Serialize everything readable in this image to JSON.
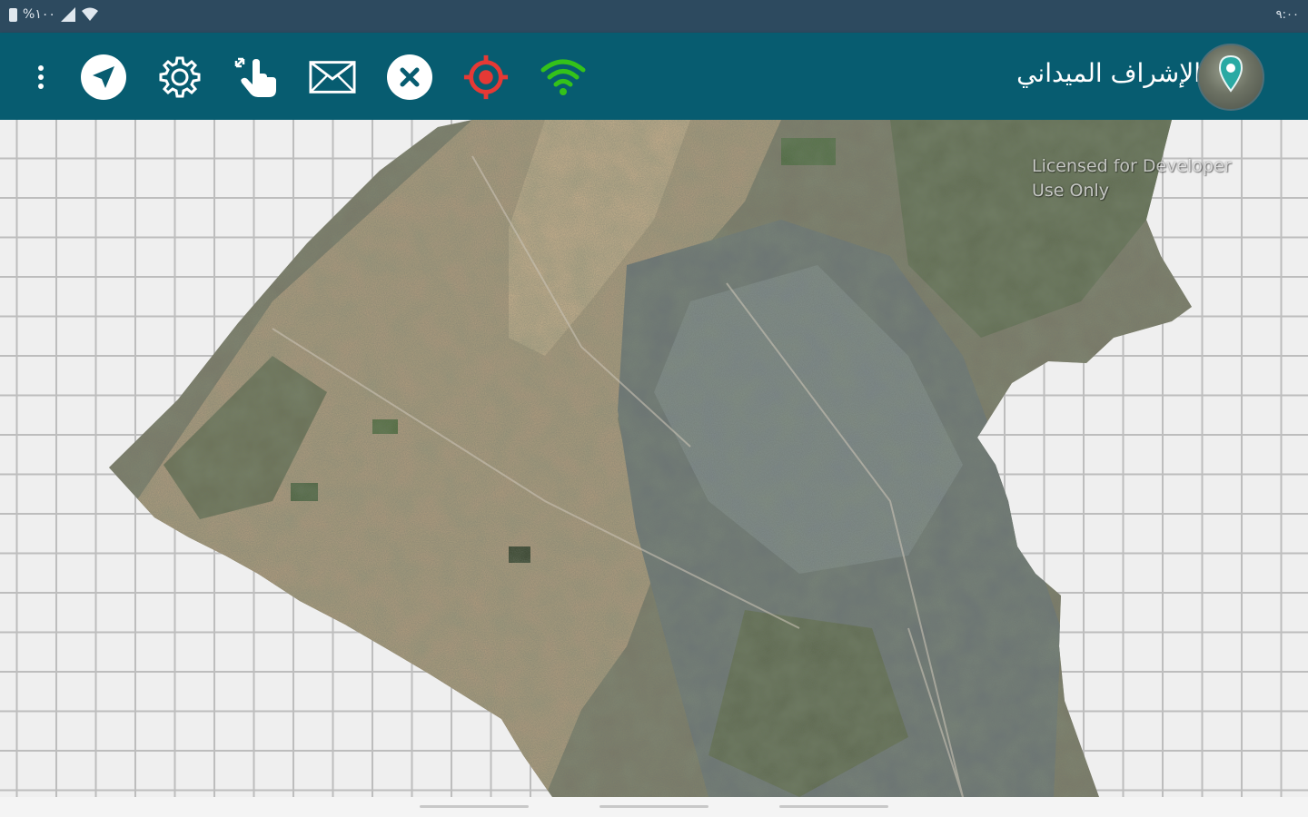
{
  "status_bar": {
    "battery_text": "%١٠٠",
    "clock": "٩:٠٠"
  },
  "toolbar": {
    "title": "الإشراف الميداني",
    "icons": {
      "overflow": "more-vert-icon",
      "navigate": "navigation-arrow-icon",
      "settings": "gear-icon",
      "touch": "touch-pan-icon",
      "mail": "envelope-icon",
      "cancel": "close-circle-icon",
      "locate": "crosshair-target-icon",
      "wifi": "wifi-icon"
    },
    "colors": {
      "background": "#075c70",
      "locate": "#e53935",
      "wifi": "#34c21a"
    }
  },
  "map": {
    "watermark_line1": "Licensed for Developer",
    "watermark_line2": "Use Only"
  }
}
